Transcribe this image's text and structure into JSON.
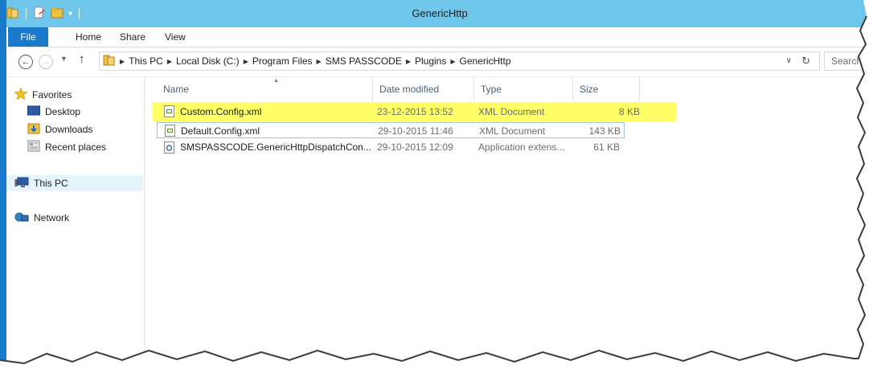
{
  "window": {
    "title": "GenericHttp",
    "frame_color": "#1979ca",
    "titlebar_color": "#6ec6ea"
  },
  "ribbon": {
    "tabs": [
      "File",
      "Home",
      "Share",
      "View"
    ]
  },
  "address": {
    "breadcrumbs": [
      "This PC",
      "Local Disk (C:)",
      "Program Files",
      "SMS PASSCODE",
      "Plugins",
      "GenericHttp"
    ],
    "search_placeholder": "Search"
  },
  "nav_pane": {
    "favorites": "Favorites",
    "favorite_items": [
      "Desktop",
      "Downloads",
      "Recent places"
    ],
    "this_pc": "This PC",
    "network": "Network"
  },
  "columns": [
    "Name",
    "Date modified",
    "Type",
    "Size"
  ],
  "files": [
    {
      "name": "Custom.Config.xml",
      "date": "23-12-2015 13:52",
      "type": "XML Document",
      "size": "8 KB",
      "icon": "xml-file-icon",
      "highlighted": true
    },
    {
      "name": "Default.Config.xml",
      "date": "29-10-2015 11:46",
      "type": "XML Document",
      "size": "143 KB",
      "icon": "xml-file-icon"
    },
    {
      "name": "SMSPASSCODE.GenericHttpDispatchCon...",
      "date": "29-10-2015 12:09",
      "type": "Application extens...",
      "size": "61 KB",
      "icon": "dll-file-icon"
    }
  ],
  "highlight_color": "#ffff66"
}
